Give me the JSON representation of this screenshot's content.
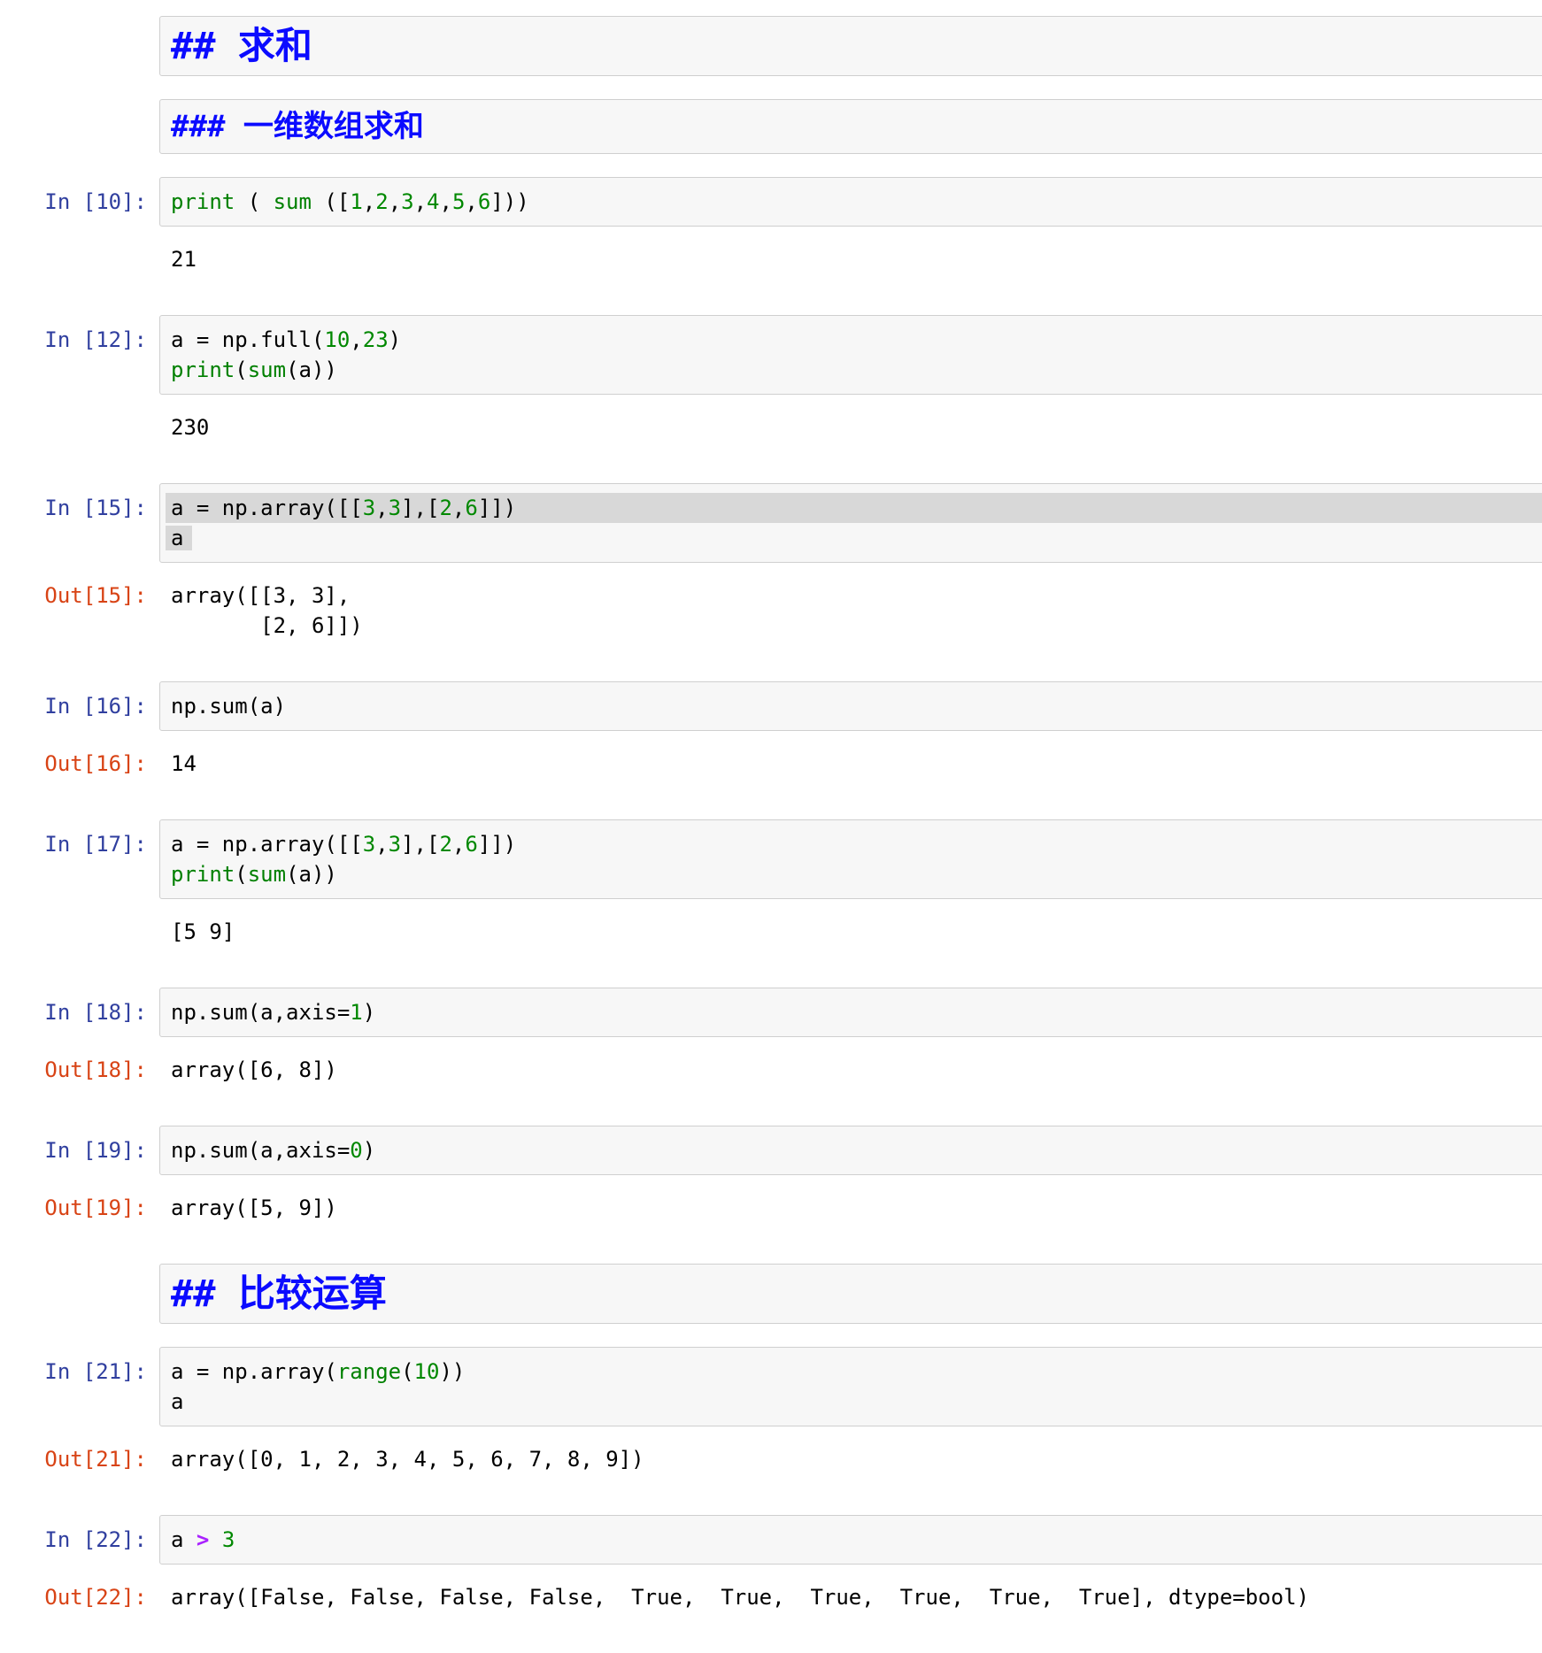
{
  "colors": {
    "in-prompt": "#303F9F",
    "out-prompt": "#D84315",
    "header-blue": "#0B0BFF",
    "tok-builtin": "#008000",
    "tok-number": "#008800",
    "tok-operator": "#AA22FF",
    "cell-bg": "#F7F7F7",
    "cell-border": "#CFCFCF",
    "selection": "#D8D8D8"
  },
  "notebook": {
    "cells": [
      {
        "type": "markdown",
        "source": "## 求和",
        "level": 2
      },
      {
        "type": "markdown",
        "source": "### 一维数组求和",
        "level": 3
      },
      {
        "type": "code",
        "prompt_in": "In [10]:",
        "lines": [
          {
            "segs": [
              {
                "t": "print",
                "c": "builtin"
              },
              {
                "t": " ( ",
                "c": "plain"
              },
              {
                "t": "sum",
                "c": "builtin"
              },
              {
                "t": " ([",
                "c": "plain"
              },
              {
                "t": "1",
                "c": "number"
              },
              {
                "t": ",",
                "c": "plain"
              },
              {
                "t": "2",
                "c": "number"
              },
              {
                "t": ",",
                "c": "plain"
              },
              {
                "t": "3",
                "c": "number"
              },
              {
                "t": ",",
                "c": "plain"
              },
              {
                "t": "4",
                "c": "number"
              },
              {
                "t": ",",
                "c": "plain"
              },
              {
                "t": "5",
                "c": "number"
              },
              {
                "t": ",",
                "c": "plain"
              },
              {
                "t": "6",
                "c": "number"
              },
              {
                "t": "]))",
                "c": "plain"
              }
            ]
          }
        ],
        "outputs": [
          {
            "prompt": "",
            "text": "21"
          }
        ]
      },
      {
        "type": "code",
        "prompt_in": "In [12]:",
        "lines": [
          {
            "segs": [
              {
                "t": "a = np.full(",
                "c": "plain"
              },
              {
                "t": "10",
                "c": "number"
              },
              {
                "t": ",",
                "c": "plain"
              },
              {
                "t": "23",
                "c": "number"
              },
              {
                "t": ")",
                "c": "plain"
              }
            ]
          },
          {
            "segs": [
              {
                "t": "print",
                "c": "builtin"
              },
              {
                "t": "(",
                "c": "plain"
              },
              {
                "t": "sum",
                "c": "builtin"
              },
              {
                "t": "(a))",
                "c": "plain"
              }
            ]
          }
        ],
        "outputs": [
          {
            "prompt": "",
            "text": "230"
          }
        ]
      },
      {
        "type": "code",
        "prompt_in": "In [15]:",
        "lines": [
          {
            "sel": "full",
            "segs": [
              {
                "t": "a = np.array([[",
                "c": "plain"
              },
              {
                "t": "3",
                "c": "number"
              },
              {
                "t": ",",
                "c": "plain"
              },
              {
                "t": "3",
                "c": "number"
              },
              {
                "t": "],[",
                "c": "plain"
              },
              {
                "t": "2",
                "c": "number"
              },
              {
                "t": ",",
                "c": "plain"
              },
              {
                "t": "6",
                "c": "number"
              },
              {
                "t": "]])",
                "c": "plain"
              }
            ]
          },
          {
            "segs": [
              {
                "t": "a",
                "c": "plain",
                "sel": true
              }
            ]
          }
        ],
        "outputs": [
          {
            "prompt": "Out[15]:",
            "text": "array([[3, 3],\n       [2, 6]])"
          }
        ]
      },
      {
        "type": "code",
        "prompt_in": "In [16]:",
        "lines": [
          {
            "segs": [
              {
                "t": "np.sum(a)",
                "c": "plain"
              }
            ]
          }
        ],
        "outputs": [
          {
            "prompt": "Out[16]:",
            "text": "14"
          }
        ]
      },
      {
        "type": "code",
        "prompt_in": "In [17]:",
        "lines": [
          {
            "segs": [
              {
                "t": "a = np.array([[",
                "c": "plain"
              },
              {
                "t": "3",
                "c": "number"
              },
              {
                "t": ",",
                "c": "plain"
              },
              {
                "t": "3",
                "c": "number"
              },
              {
                "t": "],[",
                "c": "plain"
              },
              {
                "t": "2",
                "c": "number"
              },
              {
                "t": ",",
                "c": "plain"
              },
              {
                "t": "6",
                "c": "number"
              },
              {
                "t": "]])",
                "c": "plain"
              }
            ]
          },
          {
            "segs": [
              {
                "t": "print",
                "c": "builtin"
              },
              {
                "t": "(",
                "c": "plain"
              },
              {
                "t": "sum",
                "c": "builtin"
              },
              {
                "t": "(a))",
                "c": "plain"
              }
            ]
          }
        ],
        "outputs": [
          {
            "prompt": "",
            "text": "[5 9]"
          }
        ]
      },
      {
        "type": "code",
        "prompt_in": "In [18]:",
        "lines": [
          {
            "segs": [
              {
                "t": "np.sum(a,axis=",
                "c": "plain"
              },
              {
                "t": "1",
                "c": "number"
              },
              {
                "t": ")",
                "c": "plain"
              }
            ]
          }
        ],
        "outputs": [
          {
            "prompt": "Out[18]:",
            "text": "array([6, 8])"
          }
        ]
      },
      {
        "type": "code",
        "prompt_in": "In [19]:",
        "lines": [
          {
            "segs": [
              {
                "t": "np.sum(a,axis=",
                "c": "plain"
              },
              {
                "t": "0",
                "c": "number"
              },
              {
                "t": ")",
                "c": "plain"
              }
            ]
          }
        ],
        "outputs": [
          {
            "prompt": "Out[19]:",
            "text": "array([5, 9])"
          }
        ]
      },
      {
        "type": "markdown",
        "source": "## 比较运算",
        "level": 2
      },
      {
        "type": "code",
        "prompt_in": "In [21]:",
        "lines": [
          {
            "segs": [
              {
                "t": "a = np.array(",
                "c": "plain"
              },
              {
                "t": "range",
                "c": "builtin"
              },
              {
                "t": "(",
                "c": "plain"
              },
              {
                "t": "10",
                "c": "number"
              },
              {
                "t": "))",
                "c": "plain"
              }
            ]
          },
          {
            "segs": [
              {
                "t": "a",
                "c": "plain"
              }
            ]
          }
        ],
        "outputs": [
          {
            "prompt": "Out[21]:",
            "text": "array([0, 1, 2, 3, 4, 5, 6, 7, 8, 9])"
          }
        ]
      },
      {
        "type": "code",
        "prompt_in": "In [22]:",
        "lines": [
          {
            "segs": [
              {
                "t": "a ",
                "c": "plain"
              },
              {
                "t": ">",
                "c": "operator"
              },
              {
                "t": " ",
                "c": "plain"
              },
              {
                "t": "3",
                "c": "number"
              }
            ]
          }
        ],
        "outputs": [
          {
            "prompt": "Out[22]:",
            "text": "array([False, False, False, False,  True,  True,  True,  True,  True,  True], dtype=bool)"
          }
        ]
      }
    ]
  }
}
